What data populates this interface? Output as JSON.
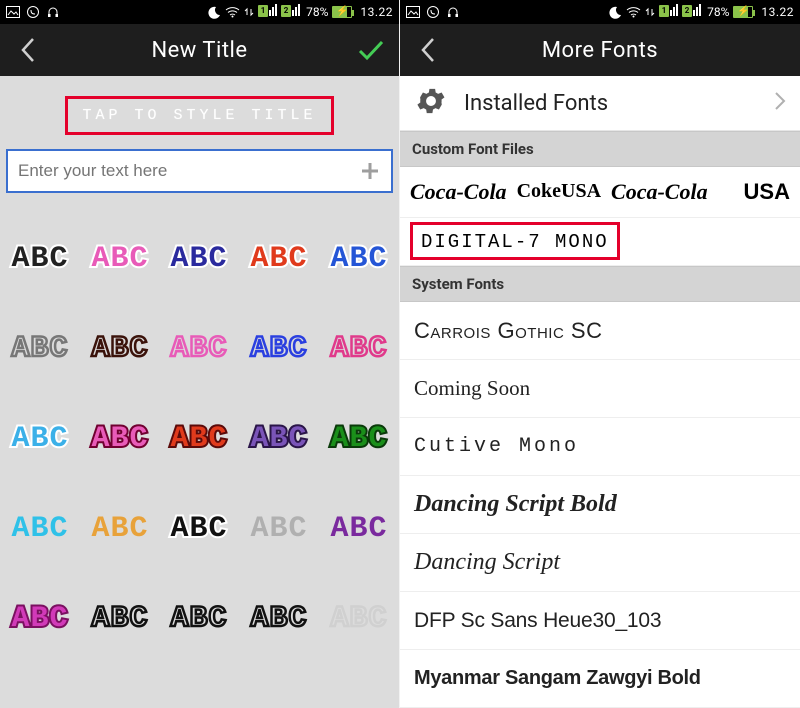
{
  "status": {
    "battery_pct": "78%",
    "time": "13.22"
  },
  "left": {
    "title": "New Title",
    "preview_text": "TAP TO STYLE TITLE",
    "input_placeholder": "Enter your text here",
    "sample": "ABC",
    "styles": [
      {
        "fill": "#222222",
        "outline": "#ffffff"
      },
      {
        "fill": "#e85bb8",
        "outline": "#ffffff"
      },
      {
        "fill": "#2a2a9e",
        "outline": "#ffffff"
      },
      {
        "fill": "#e03a1c",
        "outline": "#ffffff"
      },
      {
        "fill": "#2455d6",
        "outline": "#ffffff"
      },
      {
        "fill": "none",
        "outline": "#777777"
      },
      {
        "fill": "none",
        "outline": "#3a120a"
      },
      {
        "fill": "none",
        "outline": "#e85bb8"
      },
      {
        "fill": "none",
        "outline": "#2a3fe0"
      },
      {
        "fill": "none",
        "outline": "#e03a8b"
      },
      {
        "fill": "#3bb0e8",
        "outline": "#ffffff"
      },
      {
        "fill": "#e85bb8",
        "outline": "#700030"
      },
      {
        "fill": "#e03a1c",
        "outline": "#5a0a0a"
      },
      {
        "fill": "#7a54b8",
        "outline": "#2a1548"
      },
      {
        "fill": "#1a8f1a",
        "outline": "#0a3a0a"
      },
      {
        "fill": "#2fc1e8",
        "outline": "none"
      },
      {
        "fill": "#e8a23a",
        "outline": "none"
      },
      {
        "fill": "#111111",
        "outline": "#ffffff"
      },
      {
        "fill": "#b0b0b0",
        "outline": "none"
      },
      {
        "fill": "#7a2a9e",
        "outline": "none"
      },
      {
        "fill": "#d13ab8",
        "outline": "#7a1060"
      },
      {
        "fill": "none",
        "outline": "#111111"
      },
      {
        "fill": "none",
        "outline": "#111111"
      },
      {
        "fill": "none",
        "outline": "#111111"
      },
      {
        "fill": "none",
        "outline": "#d0d0d0"
      }
    ]
  },
  "right": {
    "title": "More Fonts",
    "installed_label": "Installed Fonts",
    "section_custom": "Custom Font Files",
    "custom_row": {
      "a": "Coca-Cola",
      "b": "CokeUSA",
      "c": "Coca-Cola",
      "d": "USA"
    },
    "digital_mono": "DIGITAL-7 MONO",
    "section_system": "System Fonts",
    "system_fonts": [
      "Carrois Gothic SC",
      "Coming Soon",
      "Cutive Mono",
      "Dancing Script Bold",
      "Dancing Script",
      "DFP Sc Sans Heue30_103",
      "Myanmar Sangam Zawgyi Bold"
    ]
  }
}
